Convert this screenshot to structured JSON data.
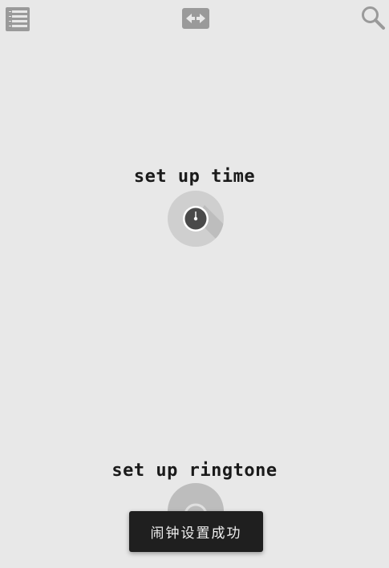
{
  "toolbar": {
    "menu_icon": "menu-list-icon",
    "swap_icon": "swap-arrows-icon",
    "search_icon": "search-icon"
  },
  "time": {
    "label": "set up time",
    "icon": "clock-dial-icon"
  },
  "ringtone": {
    "label": "set up ringtone",
    "icon": "headphones-dial-icon"
  },
  "toast": {
    "message": "闹钟设置成功"
  },
  "colors": {
    "background": "#e8e8e8",
    "icon_gray": "#9a9a9a",
    "dial_light": "#cfcfcf",
    "dial_dark": "#4a4a4a",
    "toast_bg": "#1f1f1f",
    "toast_text": "#f0f0f0"
  }
}
